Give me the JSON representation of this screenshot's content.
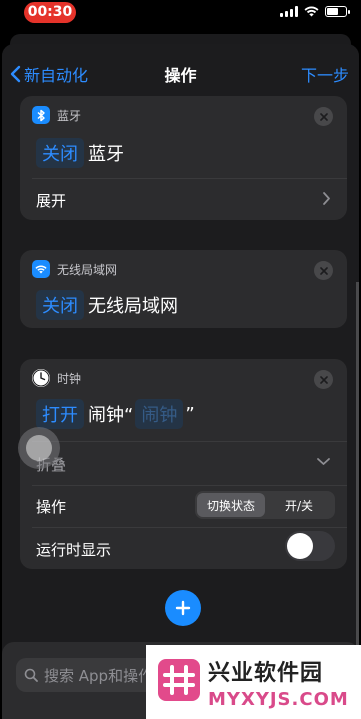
{
  "status": {
    "time": "00:30"
  },
  "nav": {
    "back_label": "新自动化",
    "title": "操作",
    "next_label": "下一步"
  },
  "cards": {
    "bluetooth": {
      "app": "蓝牙",
      "verb": "关闭",
      "object": "蓝牙",
      "expand_label": "展开",
      "icon": "bluetooth-icon",
      "color": "#1a8cff"
    },
    "wifi": {
      "app": "无线局域网",
      "verb": "关闭",
      "object": "无线局域网",
      "icon": "wifi-icon",
      "color": "#1a8cff"
    },
    "clock": {
      "app": "时钟",
      "verb": "打开",
      "object_prefix": "闹钟“",
      "object_token": "闹钟",
      "object_suffix": "”",
      "collapse_label": "折叠",
      "operation_label": "操作",
      "segments": [
        "切换状态",
        "开/关"
      ],
      "selected_segment": "切换状态",
      "show_when_run_label": "运行时显示",
      "show_when_run": false,
      "icon": "clock-icon"
    }
  },
  "search": {
    "placeholder": "搜索 App和操作"
  },
  "watermark": {
    "title": "兴业软件园",
    "subtitle": "MYXYJS.COM"
  }
}
